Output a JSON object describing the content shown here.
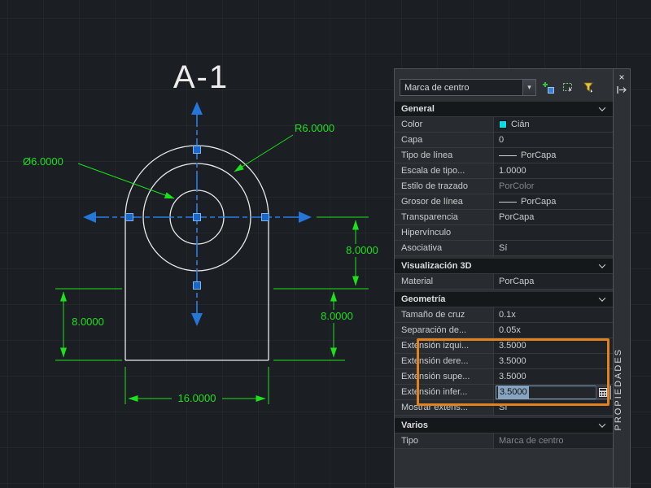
{
  "canvas": {
    "title_label": "A-1",
    "dims": {
      "diameter": "Ø6.0000",
      "radius": "R6.0000",
      "right_upper": "8.0000",
      "right_lower": "8.0000",
      "left": "8.0000",
      "bottom": "16.0000"
    },
    "colors": {
      "dimension_green": "#1de11d",
      "geometry_white": "#e9e9e9",
      "grip_blue": "#2576d9",
      "background": "#1b1e23"
    }
  },
  "palette": {
    "strip_title": "PROPIEDADES",
    "selector_value": "Marca de centro",
    "toolbar": {
      "pickadd": "toggle-pickadd",
      "select_objects": "select-objects",
      "quick_select": "quick-select"
    },
    "icons": {
      "close": "×",
      "dropdown_arrow": "▾"
    },
    "highlight_color": "#e1821f",
    "sections": {
      "general": {
        "title": "General",
        "rows": [
          {
            "label": "Color",
            "value": "Cián",
            "swatch": "#00dfe4"
          },
          {
            "label": "Capa",
            "value": "0"
          },
          {
            "label": "Tipo de línea",
            "value": "PorCapa"
          },
          {
            "label": "Escala de tipo...",
            "value": "1.0000"
          },
          {
            "label": "Estilo de trazado",
            "value": "PorColor"
          },
          {
            "label": "Grosor de línea",
            "value": "PorCapa"
          },
          {
            "label": "Transparencia",
            "value": "PorCapa"
          },
          {
            "label": "Hipervínculo",
            "value": ""
          },
          {
            "label": "Asociativa",
            "value": "Sí"
          }
        ]
      },
      "viz3d": {
        "title": "Visualización 3D",
        "rows": [
          {
            "label": "Material",
            "value": "PorCapa"
          }
        ]
      },
      "geometria": {
        "title": "Geometría",
        "rows": [
          {
            "label": "Tamaño de cruz",
            "value": "0.1x"
          },
          {
            "label": "Separación de...",
            "value": "0.05x"
          },
          {
            "label": "Extensión izqui...",
            "value": "3.5000"
          },
          {
            "label": "Extensión dere...",
            "value": "3.5000"
          },
          {
            "label": "Extensión supe...",
            "value": "3.5000"
          },
          {
            "label": "Extensión infer...",
            "value": "3.5000"
          },
          {
            "label": "Mostrar extens...",
            "value": "Sí"
          }
        ]
      },
      "varios": {
        "title": "Varios",
        "rows": [
          {
            "label": "Tipo",
            "value": "Marca de centro"
          }
        ]
      }
    }
  }
}
